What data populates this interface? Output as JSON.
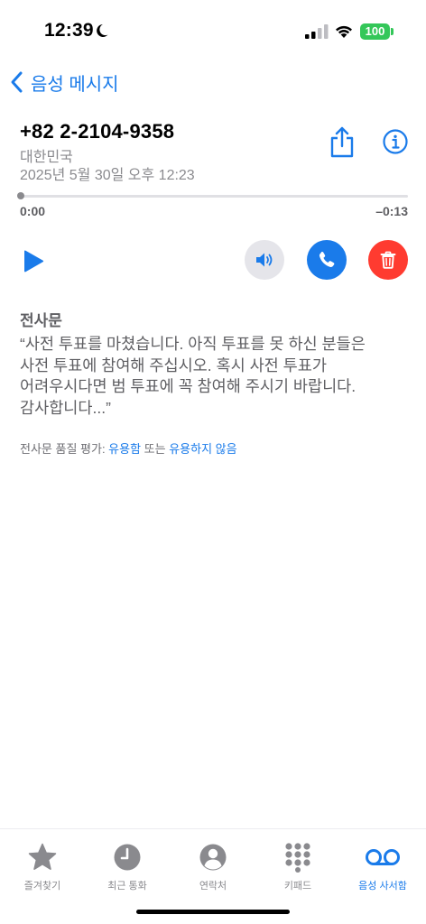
{
  "status_bar": {
    "time": "12:39",
    "battery": "100"
  },
  "nav": {
    "back_label": "음성 메시지"
  },
  "message": {
    "phone_number": "+82 2-2104-9358",
    "region": "대한민국",
    "datetime": "2025년 5월 30일 오후 12:23"
  },
  "player": {
    "elapsed": "0:00",
    "remaining": "–0:13",
    "progress": 0
  },
  "transcript": {
    "title": "전사문",
    "text": "“사전 투표를 마쳤습니다. 아직 투표를 못 하신 분들은\n 사전 투표에 참여해 주십시오. 혹시 사전 투표가\n 어려우시다면 범 투표에 꼭 참여해 주시기 바랍니다.\n 감사합니다...”",
    "rating_prefix": "전사문 품질 평가: ",
    "rating_useful": "유용함",
    "rating_or": " 또는 ",
    "rating_not_useful": "유용하지 않음"
  },
  "tabs": [
    {
      "label": "즐겨찾기",
      "icon": "star-icon"
    },
    {
      "label": "최근 통화",
      "icon": "clock-icon"
    },
    {
      "label": "연락처",
      "icon": "person-icon"
    },
    {
      "label": "키패드",
      "icon": "keypad-icon"
    },
    {
      "label": "음성 사서함",
      "icon": "voicemail-icon",
      "active": true
    }
  ],
  "colors": {
    "accent": "#1a7bea",
    "delete": "#ff3b30",
    "battery": "#34c759",
    "secondary_text": "#8a8a8e"
  }
}
